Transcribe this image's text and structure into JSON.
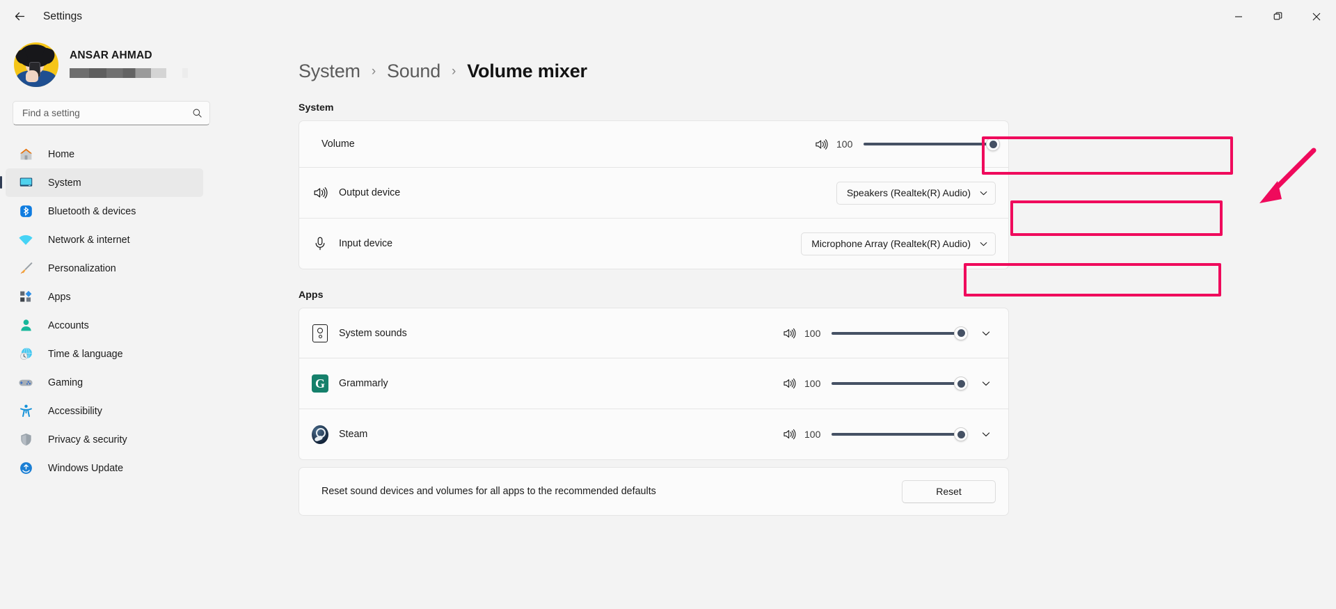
{
  "window": {
    "title": "Settings",
    "back_icon": "arrow-left-icon",
    "minimize_label": "Minimize",
    "maximize_label": "Restore",
    "close_label": "Close"
  },
  "account": {
    "name": "ANSAR AHMAD",
    "email_redacted": "",
    "avatar_alt": "user-avatar"
  },
  "search": {
    "placeholder": "Find a setting",
    "value": "",
    "icon": "search-icon"
  },
  "sidebar": {
    "items": [
      {
        "label": "Home",
        "icon": "home-icon",
        "active": false
      },
      {
        "label": "System",
        "icon": "display-icon",
        "active": true
      },
      {
        "label": "Bluetooth & devices",
        "icon": "bluetooth-icon",
        "active": false
      },
      {
        "label": "Network & internet",
        "icon": "wifi-icon",
        "active": false
      },
      {
        "label": "Personalization",
        "icon": "paintbrush-icon",
        "active": false
      },
      {
        "label": "Apps",
        "icon": "apps-icon",
        "active": false
      },
      {
        "label": "Accounts",
        "icon": "person-icon",
        "active": false
      },
      {
        "label": "Time & language",
        "icon": "clock-globe-icon",
        "active": false
      },
      {
        "label": "Gaming",
        "icon": "gamepad-icon",
        "active": false
      },
      {
        "label": "Accessibility",
        "icon": "accessibility-icon",
        "active": false
      },
      {
        "label": "Privacy & security",
        "icon": "shield-icon",
        "active": false
      },
      {
        "label": "Windows Update",
        "icon": "update-icon",
        "active": false
      }
    ]
  },
  "breadcrumb": {
    "root": "System",
    "parent": "Sound",
    "current": "Volume mixer",
    "separator": "›"
  },
  "system_section": {
    "heading": "System",
    "volume_row": {
      "label": "Volume",
      "speaker_icon": "speaker-icon",
      "value": "100",
      "percent": 100
    },
    "output_row": {
      "label": "Output device",
      "icon": "speaker-icon",
      "selected": "Speakers (Realtek(R) Audio)",
      "chevron": "chevron-down-icon"
    },
    "input_row": {
      "label": "Input device",
      "icon": "microphone-icon",
      "selected": "Microphone Array (Realtek(R) Audio)",
      "chevron": "chevron-down-icon"
    }
  },
  "apps_section": {
    "heading": "Apps",
    "rows": [
      {
        "name": "System sounds",
        "icon": "system-sounds-icon",
        "value": "100",
        "percent": 100,
        "speaker_icon": "speaker-icon",
        "chevron": "chevron-down-icon"
      },
      {
        "name": "Grammarly",
        "icon": "grammarly-icon",
        "value": "100",
        "percent": 100,
        "speaker_icon": "speaker-icon",
        "chevron": "chevron-down-icon"
      },
      {
        "name": "Steam",
        "icon": "steam-icon",
        "value": "100",
        "percent": 100,
        "speaker_icon": "speaker-icon",
        "chevron": "chevron-down-icon"
      }
    ],
    "reset_row": {
      "description": "Reset sound devices and volumes for all apps to the recommended defaults",
      "button_label": "Reset"
    }
  },
  "annotations": {
    "accent_color": "#ef0a5c",
    "highlight_boxes": [
      "volume-slider",
      "output-device-dropdown",
      "input-device-dropdown"
    ],
    "arrow": "pointer-arrow"
  }
}
